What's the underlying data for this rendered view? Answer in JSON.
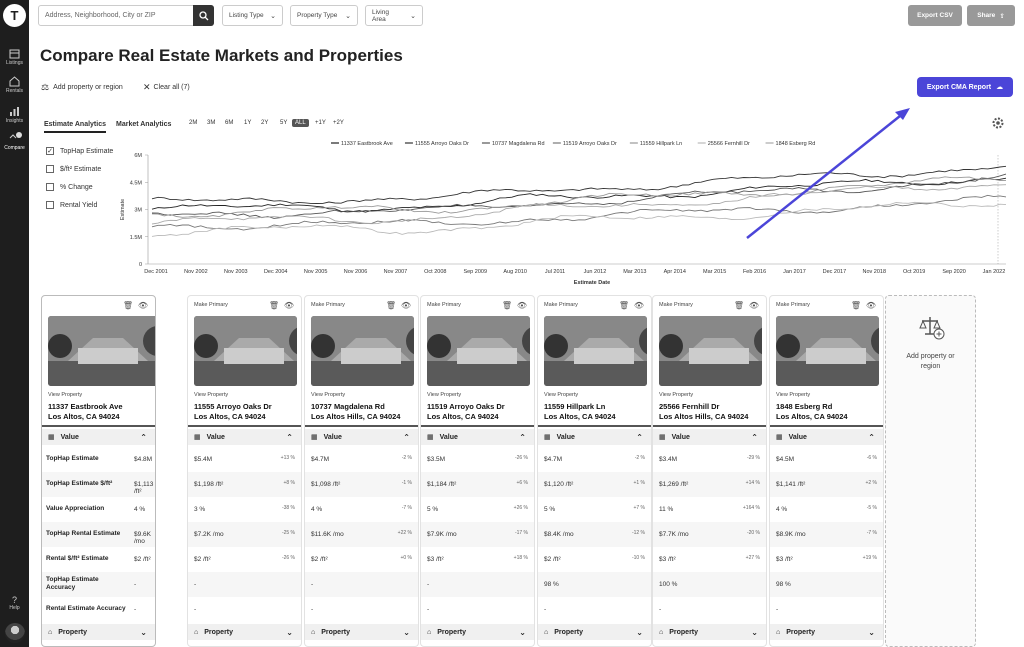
{
  "nav": {
    "logo": "T",
    "items": [
      {
        "label": "Listings",
        "icon": "listings-icon"
      },
      {
        "label": "Rentals",
        "icon": "rentals-icon"
      },
      {
        "label": "Insights",
        "icon": "insights-icon"
      },
      {
        "label": "Compare",
        "icon": "compare-icon",
        "badge": "7"
      }
    ],
    "help": "Help"
  },
  "topbar": {
    "search_placeholder": "Address, Neighborhood, City or ZIP",
    "filters": [
      "Listing Type",
      "Property Type",
      "Living Area"
    ],
    "export_csv": "Export CSV",
    "share": "Share"
  },
  "page": {
    "title": "Compare Real Estate Markets and Properties",
    "add_property": "Add property or region",
    "clear_all": "Clear all (7)",
    "export_cma": "Export CMA Report"
  },
  "analytics": {
    "tabs": [
      "Estimate Analytics",
      "Market Analytics"
    ],
    "ranges": [
      "2M",
      "3M",
      "6M",
      "1Y",
      "2Y",
      "5Y",
      "ALL",
      "+1Y",
      "+2Y"
    ],
    "active_range": "ALL",
    "options": [
      {
        "label": "TopHap Estimate",
        "checked": true
      },
      {
        "label": "$/ft² Estimate",
        "checked": false
      },
      {
        "label": "% Change",
        "checked": false
      },
      {
        "label": "Rental Yield",
        "checked": false
      }
    ]
  },
  "chart_data": {
    "type": "line",
    "xlabel": "Estimate Date",
    "ylabel": "Estimate",
    "y_ticks": [
      "0",
      "1.5M",
      "3M",
      "4.5M",
      "6M"
    ],
    "ylim": [
      0,
      6000000
    ],
    "x_ticks": [
      "Dec 2001",
      "Nov 2002",
      "Nov 2003",
      "Dec 2004",
      "Nov 2005",
      "Nov 2006",
      "Nov 2007",
      "Oct 2008",
      "Sep 2009",
      "Aug 2010",
      "Jul 2011",
      "Jun 2012",
      "Mar 2013",
      "Apr 2014",
      "Mar 2015",
      "Feb 2016",
      "Jan 2017",
      "Dec 2017",
      "Nov 2018",
      "Oct 2019",
      "Sep 2020",
      "Jan 2022"
    ],
    "series": [
      {
        "name": "11337 Eastbrook Ave",
        "color": "#222222",
        "start": 3000000,
        "end": 4800000
      },
      {
        "name": "11555 Arroyo Oaks Dr",
        "color": "#333333",
        "start": 3400000,
        "end": 5400000
      },
      {
        "name": "10737 Magdalena Rd",
        "color": "#555555",
        "start": 2700000,
        "end": 4700000
      },
      {
        "name": "11519 Arroyo Oaks Dr",
        "color": "#777777",
        "start": 2100000,
        "end": 3500000
      },
      {
        "name": "11559 Hillpark Ln",
        "color": "#999999",
        "start": 2800000,
        "end": 4700000
      },
      {
        "name": "25566 Fernhill Dr",
        "color": "#bbbbbb",
        "start": 1800000,
        "end": 3400000
      },
      {
        "name": "1848 Esberg Rd",
        "color": "#aaaaaa",
        "start": 2300000,
        "end": 4500000
      }
    ]
  },
  "rows": [
    "TopHap Estimate",
    "TopHap Estimate $/ft²",
    "Value Appreciation",
    "TopHap Rental Estimate",
    "Rental $/ft² Estimate",
    "TopHap Estimate Accuracy",
    "Rental Estimate Accuracy"
  ],
  "card_labels": {
    "make_primary": "Make Primary",
    "view_property": "View Property",
    "value": "Value",
    "property": "Property"
  },
  "cards": [
    {
      "a1": "11337 Eastbrook Ave",
      "a2": "Los Altos, CA 94024",
      "primary": true,
      "vals": [
        "$4.8M",
        "$1,113 /ft²",
        "4 %",
        "$9.6K /mo",
        "$2 /ft²",
        "-",
        "-"
      ],
      "pcts": [
        "",
        "",
        "",
        "",
        "",
        "",
        ""
      ]
    },
    {
      "a1": "11555 Arroyo Oaks Dr",
      "a2": "Los Altos, CA 94024",
      "vals": [
        "$5.4M",
        "$1,198 /ft²",
        "3 %",
        "$7.2K /mo",
        "$2 /ft²",
        "-",
        "-"
      ],
      "pcts": [
        "+13 %",
        "+8 %",
        "-38 %",
        "-25 %",
        "-26 %",
        "",
        ""
      ]
    },
    {
      "a1": "10737 Magdalena Rd",
      "a2": "Los Altos Hills, CA 94024",
      "vals": [
        "$4.7M",
        "$1,098 /ft²",
        "4 %",
        "$11.6K /mo",
        "$2 /ft²",
        "-",
        "-"
      ],
      "pcts": [
        "-2 %",
        "-1 %",
        "-7 %",
        "+22 %",
        "+0 %",
        "",
        ""
      ]
    },
    {
      "a1": "11519 Arroyo Oaks Dr",
      "a2": "Los Altos, CA 94024",
      "vals": [
        "$3.5M",
        "$1,184 /ft²",
        "5 %",
        "$7.9K /mo",
        "$3 /ft²",
        "-",
        "-"
      ],
      "pcts": [
        "-26 %",
        "+6 %",
        "+26 %",
        "-17 %",
        "+18 %",
        "",
        ""
      ]
    },
    {
      "a1": "11559 Hillpark Ln",
      "a2": "Los Altos, CA 94024",
      "vals": [
        "$4.7M",
        "$1,120 /ft²",
        "5 %",
        "$8.4K /mo",
        "$2 /ft²",
        "98 %",
        "-"
      ],
      "pcts": [
        "-2 %",
        "+1 %",
        "+7 %",
        "-12 %",
        "-10 %",
        "",
        ""
      ]
    },
    {
      "a1": "25566 Fernhill Dr",
      "a2": "Los Altos Hills, CA 94024",
      "vals": [
        "$3.4M",
        "$1,269 /ft²",
        "11 %",
        "$7.7K /mo",
        "$3 /ft²",
        "100 %",
        "-"
      ],
      "pcts": [
        "-29 %",
        "+14 %",
        "+164 %",
        "-20 %",
        "+27 %",
        "",
        ""
      ]
    },
    {
      "a1": "1848 Esberg Rd",
      "a2": "Los Altos, CA 94024",
      "vals": [
        "$4.5M",
        "$1,141 /ft²",
        "4 %",
        "$8.9K /mo",
        "$3 /ft²",
        "98 %",
        "-"
      ],
      "pcts": [
        "-6 %",
        "+2 %",
        "-5 %",
        "-7 %",
        "+19 %",
        "",
        ""
      ]
    }
  ],
  "add_card": "Add property or region"
}
